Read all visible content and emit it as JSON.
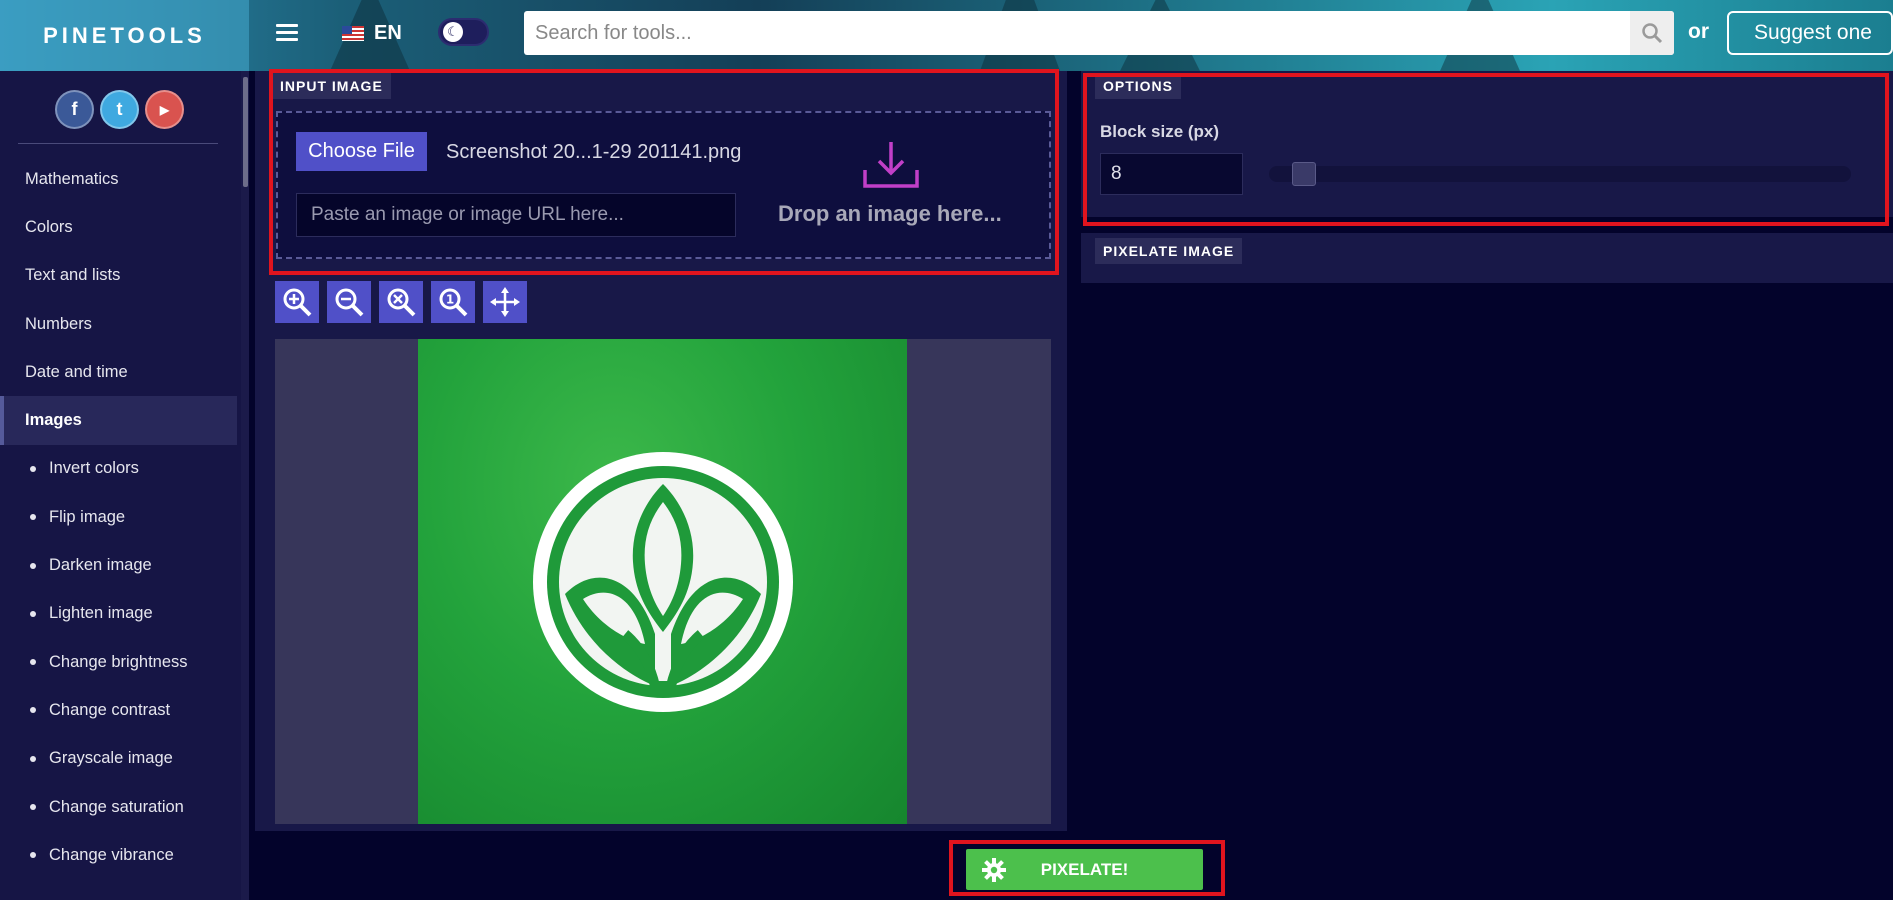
{
  "header": {
    "logo": "PINETOOLS",
    "language": "EN",
    "search_placeholder": "Search for tools...",
    "or_text": "or",
    "suggest_label": "Suggest one"
  },
  "social": {
    "facebook": "f",
    "twitter": "t",
    "youtube": "▶"
  },
  "sidebar": {
    "items": [
      {
        "label": "Mathematics"
      },
      {
        "label": "Colors"
      },
      {
        "label": "Text and lists"
      },
      {
        "label": "Numbers"
      },
      {
        "label": "Date and time"
      },
      {
        "label": "Images"
      }
    ],
    "subitems": [
      {
        "label": "Invert colors"
      },
      {
        "label": "Flip image"
      },
      {
        "label": "Darken image"
      },
      {
        "label": "Lighten image"
      },
      {
        "label": "Change brightness"
      },
      {
        "label": "Change contrast"
      },
      {
        "label": "Grayscale image"
      },
      {
        "label": "Change saturation"
      },
      {
        "label": "Change vibrance"
      }
    ]
  },
  "input_image": {
    "title": "INPUT IMAGE",
    "choose_file_label": "Choose File",
    "file_name": "Screenshot 20...1-29 201141.png",
    "url_placeholder": "Paste an image or image URL here...",
    "drop_text": "Drop an image here..."
  },
  "options": {
    "title": "OPTIONS",
    "block_size_label": "Block size (px)",
    "block_size_value": "8"
  },
  "pixelate_image": {
    "title": "PIXELATE IMAGE"
  },
  "action": {
    "pixelate_label": "PIXELATE!"
  },
  "colors": {
    "accent": "#5050c8",
    "action_green": "#4cc04c",
    "highlight_red": "#e0141e",
    "background": "#03032b"
  }
}
